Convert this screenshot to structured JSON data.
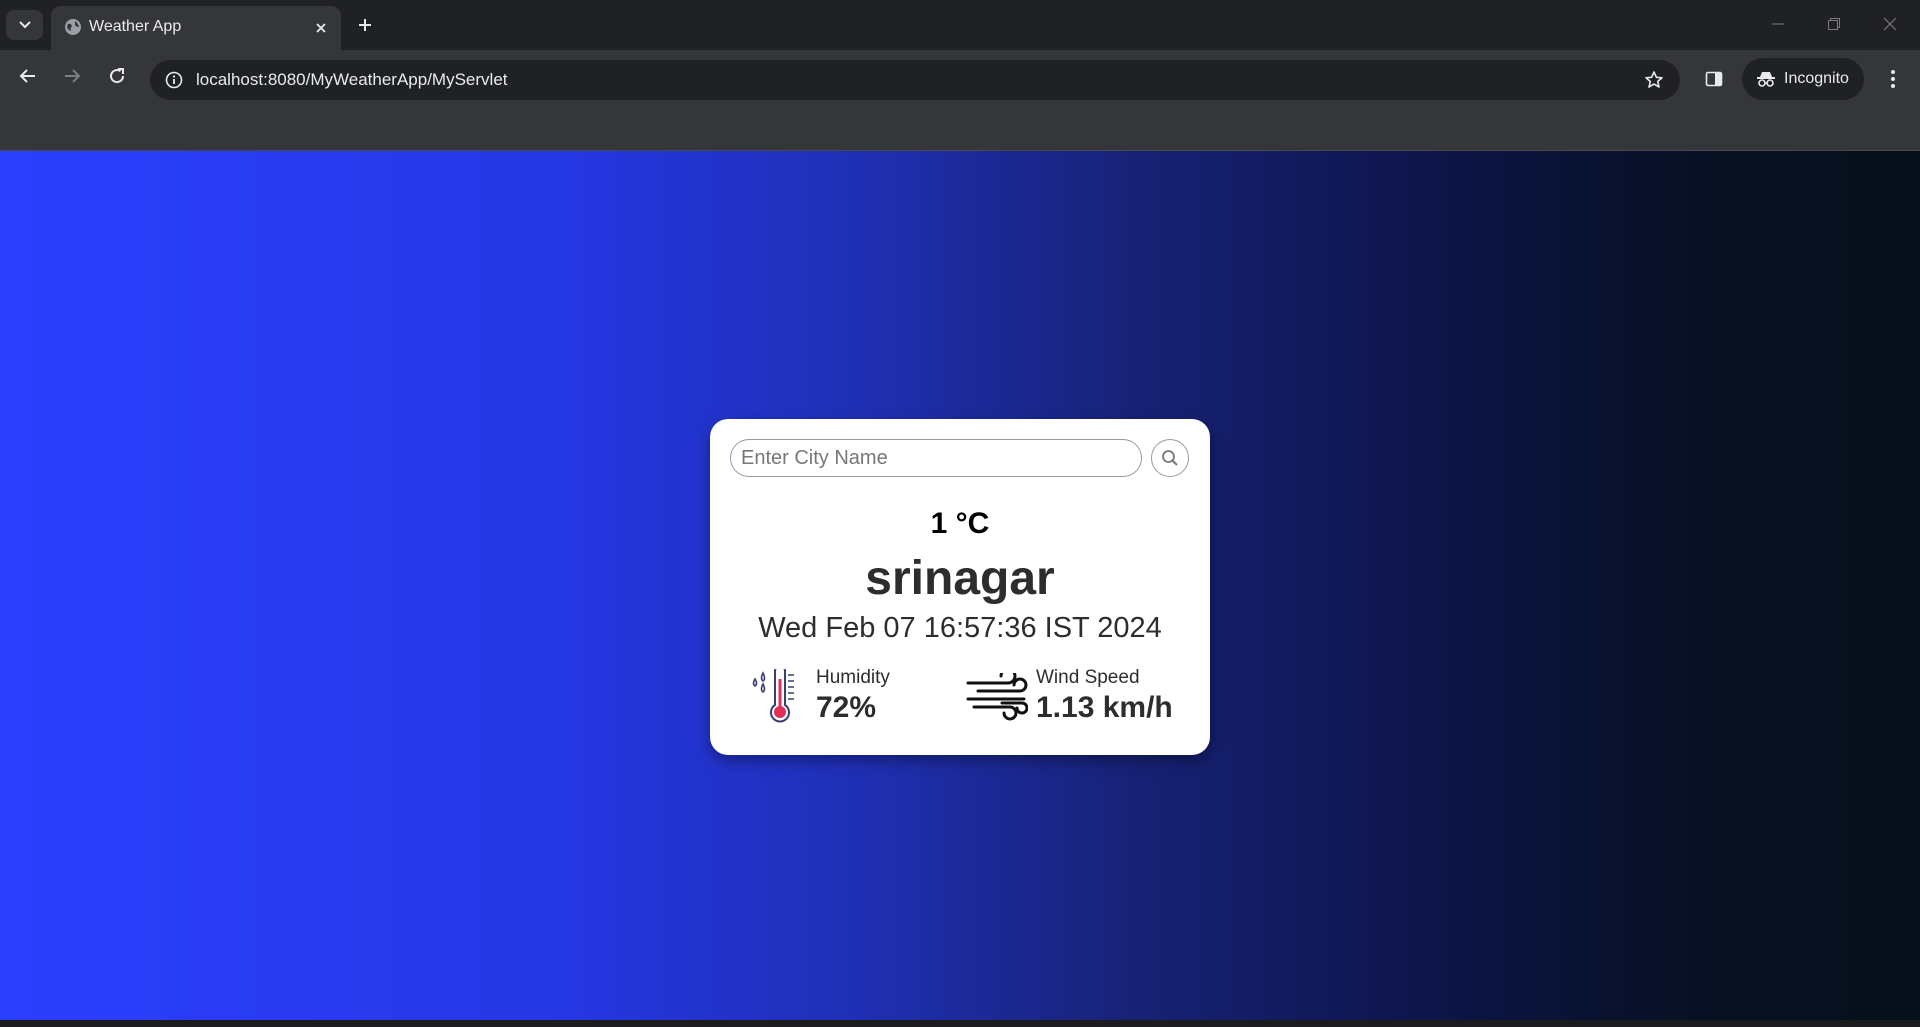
{
  "browser": {
    "tab": {
      "title": "Weather App",
      "favicon": "globe-icon"
    },
    "url": "localhost:8080/MyWeatherApp/MyServlet",
    "incognito_label": "Incognito"
  },
  "weather": {
    "search_placeholder": "Enter City Name",
    "temperature": "1 °C",
    "city": "srinagar",
    "datetime": "Wed Feb 07 16:57:36 IST 2024",
    "humidity_label": "Humidity",
    "humidity_value": "72%",
    "wind_label": "Wind Speed",
    "wind_value": "1.13 km/h"
  },
  "colors": {
    "gradient_start": "#2b3fff",
    "gradient_end": "#06101a",
    "card_bg": "#ffffff",
    "thermometer_red": "#e0305a"
  }
}
